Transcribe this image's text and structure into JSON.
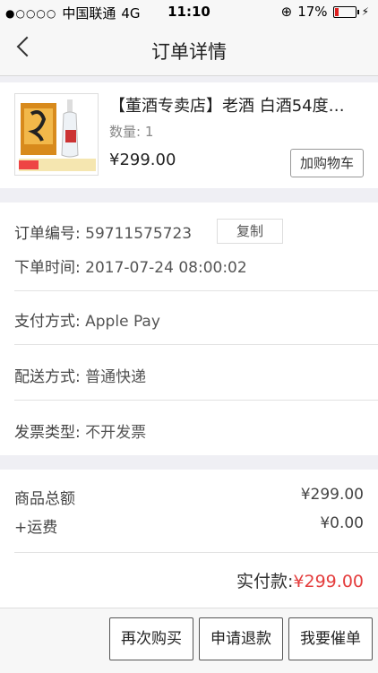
{
  "status": {
    "carrier": "中国联通",
    "network": "4G",
    "time": "11:10",
    "battery": "17%",
    "battery_fraction": 0.17
  },
  "nav": {
    "title": "订单详情",
    "back_icon": "chevron-left-icon"
  },
  "product": {
    "title": "【董酒专卖店】老酒 白酒54度…",
    "quantity": "数量: 1",
    "price": "¥299.00",
    "add_to_cart": "加购物车"
  },
  "order": {
    "number_label": "订单编号:",
    "number_value": "59711575723",
    "copy_button": "复制",
    "time_label": "下单时间:",
    "time_value": "2017-07-24 08:00:02",
    "payment_label": "支付方式:",
    "payment_value": "Apple Pay",
    "delivery_label": "配送方式:",
    "delivery_value": "普通快递",
    "invoice_label": "发票类型:",
    "invoice_value": "不开发票"
  },
  "totals": {
    "goods_label": "商品总额",
    "goods_value": "¥299.00",
    "shipping_label": "+运费",
    "shipping_value": "¥0.00",
    "paid_label": "实付款:",
    "paid_value": "¥299.00",
    "paid_color": "#e43d3d"
  },
  "actions": {
    "buy_again": "再次购买",
    "refund": "申请退款",
    "urge": "我要催单"
  }
}
